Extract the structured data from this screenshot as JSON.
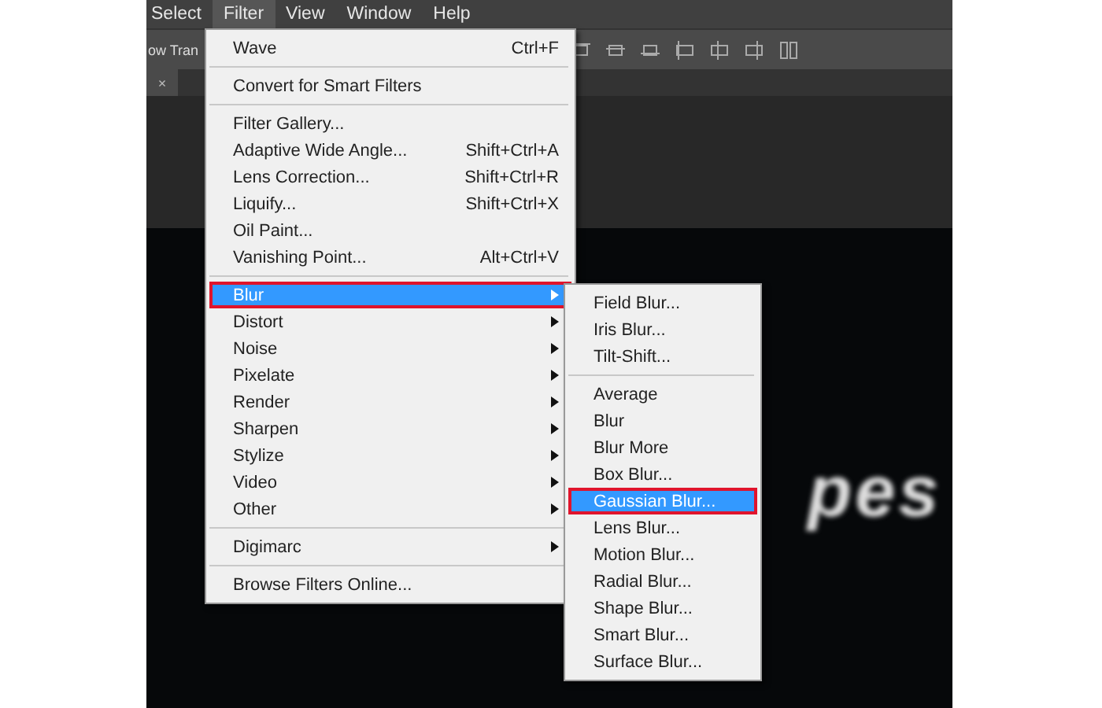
{
  "menu_bar": [
    {
      "label": "Select",
      "selected": false
    },
    {
      "label": "Filter",
      "selected": true
    },
    {
      "label": "View",
      "selected": false
    },
    {
      "label": "Window",
      "selected": false
    },
    {
      "label": "Help",
      "selected": false
    }
  ],
  "options_bar": {
    "text": "ow Tran"
  },
  "document_tab": {
    "close": "×"
  },
  "canvas": {
    "text": "pes"
  },
  "filter_menu": [
    {
      "kind": "item",
      "label": "Wave",
      "shortcut": "Ctrl+F",
      "submenu": false,
      "selected": false,
      "outlined": false
    },
    {
      "kind": "separator"
    },
    {
      "kind": "item",
      "label": "Convert for Smart Filters",
      "submenu": false,
      "selected": false,
      "outlined": false
    },
    {
      "kind": "separator"
    },
    {
      "kind": "item",
      "label": "Filter Gallery...",
      "submenu": false,
      "selected": false,
      "outlined": false
    },
    {
      "kind": "item",
      "label": "Adaptive Wide Angle...",
      "shortcut": "Shift+Ctrl+A",
      "submenu": false,
      "selected": false,
      "outlined": false
    },
    {
      "kind": "item",
      "label": "Lens Correction...",
      "shortcut": "Shift+Ctrl+R",
      "submenu": false,
      "selected": false,
      "outlined": false
    },
    {
      "kind": "item",
      "label": "Liquify...",
      "shortcut": "Shift+Ctrl+X",
      "submenu": false,
      "selected": false,
      "outlined": false
    },
    {
      "kind": "item",
      "label": "Oil Paint...",
      "submenu": false,
      "selected": false,
      "outlined": false
    },
    {
      "kind": "item",
      "label": "Vanishing Point...",
      "shortcut": "Alt+Ctrl+V",
      "submenu": false,
      "selected": false,
      "outlined": false
    },
    {
      "kind": "separator"
    },
    {
      "kind": "item",
      "label": "Blur",
      "submenu": true,
      "selected": true,
      "outlined": true
    },
    {
      "kind": "item",
      "label": "Distort",
      "submenu": true,
      "selected": false,
      "outlined": false
    },
    {
      "kind": "item",
      "label": "Noise",
      "submenu": true,
      "selected": false,
      "outlined": false
    },
    {
      "kind": "item",
      "label": "Pixelate",
      "submenu": true,
      "selected": false,
      "outlined": false
    },
    {
      "kind": "item",
      "label": "Render",
      "submenu": true,
      "selected": false,
      "outlined": false
    },
    {
      "kind": "item",
      "label": "Sharpen",
      "submenu": true,
      "selected": false,
      "outlined": false
    },
    {
      "kind": "item",
      "label": "Stylize",
      "submenu": true,
      "selected": false,
      "outlined": false
    },
    {
      "kind": "item",
      "label": "Video",
      "submenu": true,
      "selected": false,
      "outlined": false
    },
    {
      "kind": "item",
      "label": "Other",
      "submenu": true,
      "selected": false,
      "outlined": false
    },
    {
      "kind": "separator"
    },
    {
      "kind": "item",
      "label": "Digimarc",
      "submenu": true,
      "selected": false,
      "outlined": false
    },
    {
      "kind": "separator"
    },
    {
      "kind": "item",
      "label": "Browse Filters Online...",
      "submenu": false,
      "selected": false,
      "outlined": false
    }
  ],
  "blur_submenu": [
    {
      "kind": "item",
      "label": "Field Blur...",
      "submenu": false,
      "selected": false,
      "outlined": false
    },
    {
      "kind": "item",
      "label": "Iris Blur...",
      "submenu": false,
      "selected": false,
      "outlined": false
    },
    {
      "kind": "item",
      "label": "Tilt-Shift...",
      "submenu": false,
      "selected": false,
      "outlined": false
    },
    {
      "kind": "separator"
    },
    {
      "kind": "item",
      "label": "Average",
      "submenu": false,
      "selected": false,
      "outlined": false
    },
    {
      "kind": "item",
      "label": "Blur",
      "submenu": false,
      "selected": false,
      "outlined": false
    },
    {
      "kind": "item",
      "label": "Blur More",
      "submenu": false,
      "selected": false,
      "outlined": false
    },
    {
      "kind": "item",
      "label": "Box Blur...",
      "submenu": false,
      "selected": false,
      "outlined": false
    },
    {
      "kind": "item",
      "label": "Gaussian Blur...",
      "submenu": false,
      "selected": true,
      "outlined": true
    },
    {
      "kind": "item",
      "label": "Lens Blur...",
      "submenu": false,
      "selected": false,
      "outlined": false
    },
    {
      "kind": "item",
      "label": "Motion Blur...",
      "submenu": false,
      "selected": false,
      "outlined": false
    },
    {
      "kind": "item",
      "label": "Radial Blur...",
      "submenu": false,
      "selected": false,
      "outlined": false
    },
    {
      "kind": "item",
      "label": "Shape Blur...",
      "submenu": false,
      "selected": false,
      "outlined": false
    },
    {
      "kind": "item",
      "label": "Smart Blur...",
      "submenu": false,
      "selected": false,
      "outlined": false
    },
    {
      "kind": "item",
      "label": "Surface Blur...",
      "submenu": false,
      "selected": false,
      "outlined": false
    }
  ]
}
